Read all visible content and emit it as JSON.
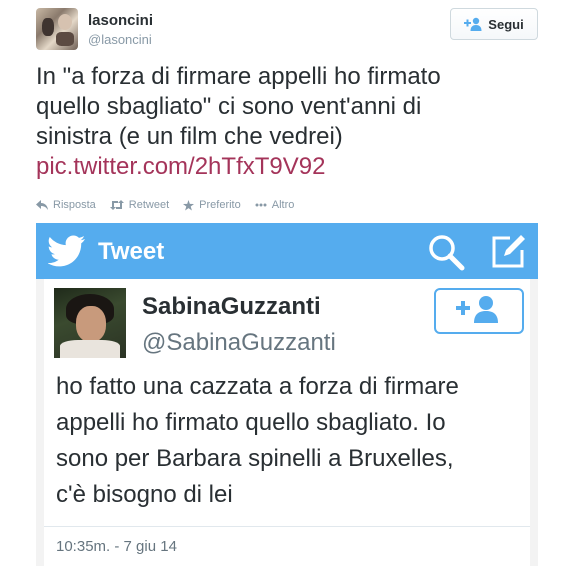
{
  "header": {
    "username": "lasoncini",
    "handle": "@lasoncini",
    "follow_label": "Segui"
  },
  "tweet": {
    "text_lines": [
      "In \"a forza di firmare appelli ho firmato",
      "quello sbagliato\" ci sono vent'anni di",
      "sinistra (e un film che vedrei)"
    ],
    "link": "pic.twitter.com/2hTfxT9V92"
  },
  "actions": {
    "reply": "Risposta",
    "retweet": "Retweet",
    "favorite": "Preferito",
    "more": "Altro"
  },
  "embedded": {
    "bar_title": "Tweet",
    "name": "SabinaGuzzanti",
    "handle": "@SabinaGuzzanti",
    "text_lines": [
      "ho fatto una cazzata a forza di firmare",
      "appelli ho firmato quello sbagliato. Io",
      "sono per Barbara spinelli a Bruxelles,",
      "c'è bisogno di lei"
    ],
    "timestamp": "10:35m. - 7 giu 14"
  },
  "colors": {
    "accent": "#55acee",
    "link": "#a4345a",
    "muted": "#8899a6"
  },
  "icons": [
    "follow-icon",
    "reply-icon",
    "retweet-icon",
    "favorite-icon",
    "more-icon",
    "twitter-bird-icon",
    "search-icon",
    "compose-icon",
    "add-user-icon"
  ]
}
